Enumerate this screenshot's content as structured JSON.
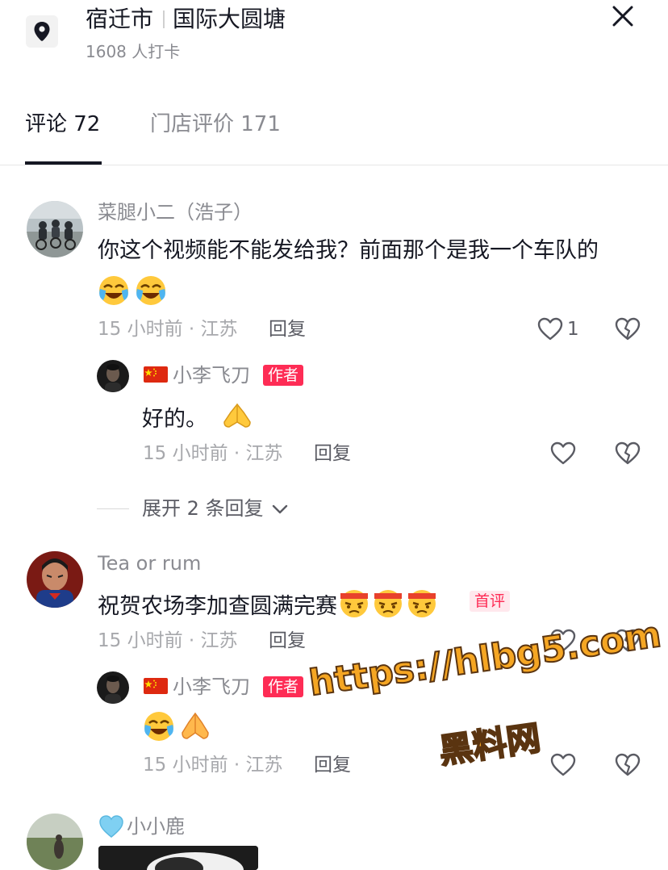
{
  "header": {
    "city": "宿迁市",
    "place": "国际大圆塘",
    "checkins": "1608 人打卡"
  },
  "tabs": [
    {
      "label": "评论 72",
      "active": true
    },
    {
      "label": "门店评价 171",
      "active": false
    }
  ],
  "comments": [
    {
      "username": "菜腿小二（浩子）",
      "text": "你这个视频能不能发给我？前面那个是我一个车队的",
      "meta": "15 小时前 · 江苏",
      "reply_label": "回复",
      "likes": "1",
      "replies": [
        {
          "username": "小李飞刀",
          "badge": "作者",
          "text": "好的。",
          "meta": "15 小时前 · 江苏",
          "reply_label": "回复"
        }
      ],
      "expand_label": "展开 2 条回复"
    },
    {
      "username": "Tea or rum",
      "text": "祝贺农场李加查圆满完赛",
      "badge": "首评",
      "meta": "15 小时前 · 江苏",
      "reply_label": "回复",
      "replies": [
        {
          "username": "小李飞刀",
          "badge": "作者",
          "meta": "15 小时前 · 江苏",
          "reply_label": "回复"
        }
      ]
    },
    {
      "username": "小小鹿"
    }
  ],
  "watermark": {
    "line1": "https://hlbg5.com",
    "line2": "黑料网"
  },
  "colors": {
    "accent": "#fe2c55",
    "text": "#161823",
    "muted": "#8a8b91",
    "watermark": "#f5a623"
  },
  "icons": [
    "location-pin-icon",
    "close-icon",
    "heart-icon",
    "dislike-heart-icon",
    "chevron-down-icon",
    "china-flag-icon",
    "light-blue-heart-icon"
  ]
}
